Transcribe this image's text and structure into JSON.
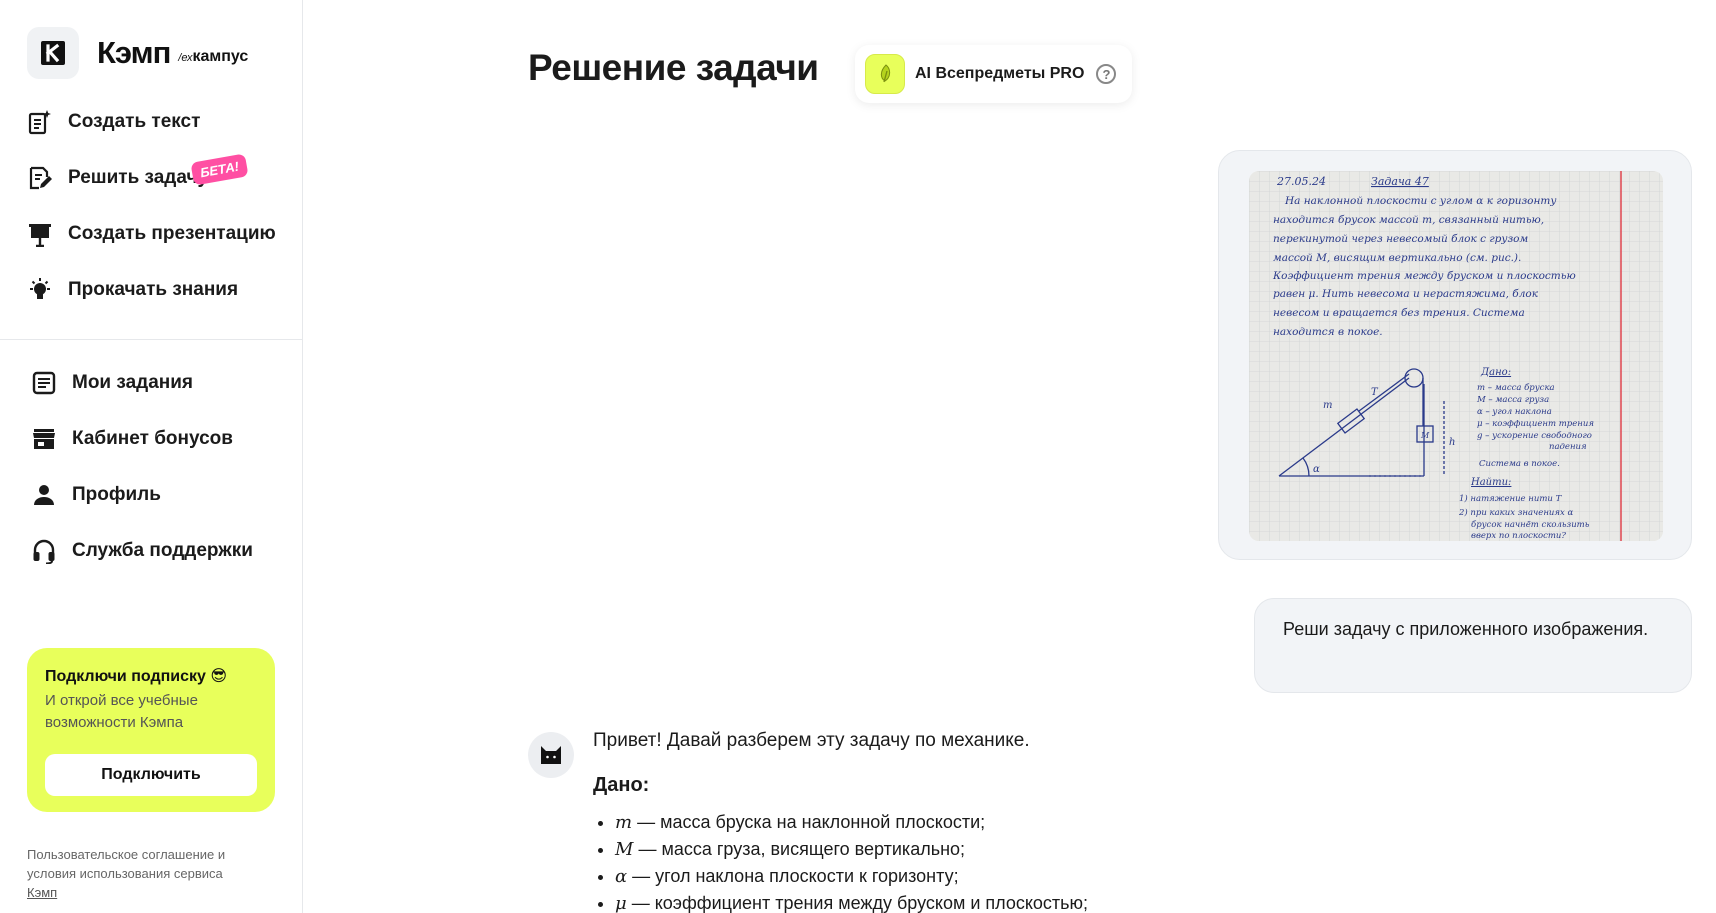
{
  "brand": {
    "name": "Кэмп",
    "sub_prefix": "/ех",
    "sub": "кампус"
  },
  "nav_top": [
    {
      "label": "Создать текст",
      "icon": "create-text-icon"
    },
    {
      "label": "Решить задачу",
      "icon": "solve-task-icon"
    },
    {
      "label": "Создать презентацию",
      "icon": "presentation-icon"
    },
    {
      "label": "Прокачать знания",
      "icon": "lightbulb-icon"
    }
  ],
  "beta_badge": "БЕТА!",
  "nav_bottom": [
    {
      "label": "Мои задания",
      "icon": "tasks-icon"
    },
    {
      "label": "Кабинет бонусов",
      "icon": "store-icon"
    },
    {
      "label": "Профиль",
      "icon": "person-icon"
    },
    {
      "label": "Служба поддержки",
      "icon": "headset-icon"
    }
  ],
  "promo": {
    "title": "Подключи подписку 😎",
    "text": "И открой все учебные возможности Кэмпа",
    "button": "Подключить",
    "color": "#e8ff5b"
  },
  "legal": {
    "text": "Пользовательское соглашение и условия использования сервиса",
    "link": "Кэмп"
  },
  "main": {
    "title": "Решение задачи",
    "model": "AI Всепредметы PRO"
  },
  "chat": {
    "user_message": "Реши задачу с приложенного изображения.",
    "image": {
      "date": "27.05.24",
      "heading": "Задача 47",
      "lines": [
        "На наклонной плоскости с углом α к горизонту",
        "находится брусок массой m, связанный нитью,",
        "перекинутой через невесомый блок с грузом",
        "массой M, висящим вертикально (см. рис.).",
        "Коэффициент трения между бруском и плоскостью",
        "равен μ. Нить невесома и нерастяжима, блок",
        "невесом и вращается без трения. Система",
        "находится в покое."
      ],
      "given_title": "Дано:",
      "given": [
        "m – масса бруска",
        "M – масса груза",
        "α – угол наклона",
        "μ – коэффициент трения",
        "g – ускорение свободного",
        "падения",
        "Система в покое."
      ],
      "find_title": "Найти:",
      "find": [
        "1) натяжение нити T",
        "2) при каких значениях α",
        "брусок начнёт скользить",
        "вверх по плоскости?"
      ],
      "labels": {
        "m": "m",
        "T": "T",
        "M": "M",
        "h": "h",
        "alpha": "α"
      }
    },
    "bot": {
      "greeting": "Привет! Давай разберем эту задачу по механике.",
      "given_title": "Дано:",
      "items": [
        {
          "var": "m",
          "text": " — масса бруска на наклонной плоскости;"
        },
        {
          "var": "M",
          "text": " — масса груза, висящего вертикально;"
        },
        {
          "var": "α",
          "text": " — угол наклона плоскости к горизонту;"
        },
        {
          "var": "μ",
          "text": " — коэффициент трения между бруском и плоскостью;"
        }
      ]
    }
  }
}
